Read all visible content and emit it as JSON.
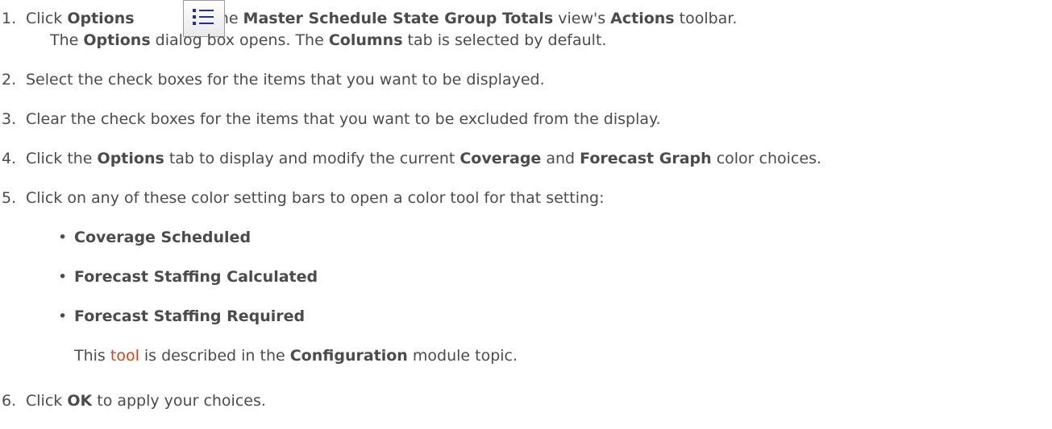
{
  "steps": [
    {
      "num": "1.",
      "parts": [
        "Click ",
        "Options",
        " on the ",
        "Master Schedule State Group Totals",
        " view's ",
        "Actions",
        " toolbar."
      ],
      "sub": [
        "The ",
        "Options",
        " dialog box opens. The ",
        "Columns",
        " tab is selected by default."
      ]
    },
    {
      "num": "2.",
      "text": "Select the check boxes for the items that you want to be displayed."
    },
    {
      "num": "3.",
      "text": "Clear the check boxes for the items that you want to be excluded from the display."
    },
    {
      "num": "4.",
      "parts": [
        "Click the ",
        "Options",
        " tab to display and modify the current ",
        "Coverage",
        " and ",
        "Forecast Graph",
        " color choices."
      ]
    },
    {
      "num": "5.",
      "text": "Click on any of these color setting bars to open a color tool for that setting:"
    },
    {
      "num": "6.",
      "parts": [
        "Click ",
        "OK",
        " to apply your choices."
      ]
    }
  ],
  "bullets": [
    "Coverage Scheduled",
    "Forecast Staffing Calculated",
    "Forecast Staffing Required"
  ],
  "bullet_char": "•",
  "note": {
    "before": "This ",
    "link": "tool",
    "middle": " is described in the ",
    "bold": "Configuration",
    "after": " module topic."
  },
  "icons": {
    "options_button": "list-icon"
  },
  "colors": {
    "link": "#d9421c",
    "icon_blue": "#1b2fa8",
    "text": "#4b4b4b"
  }
}
